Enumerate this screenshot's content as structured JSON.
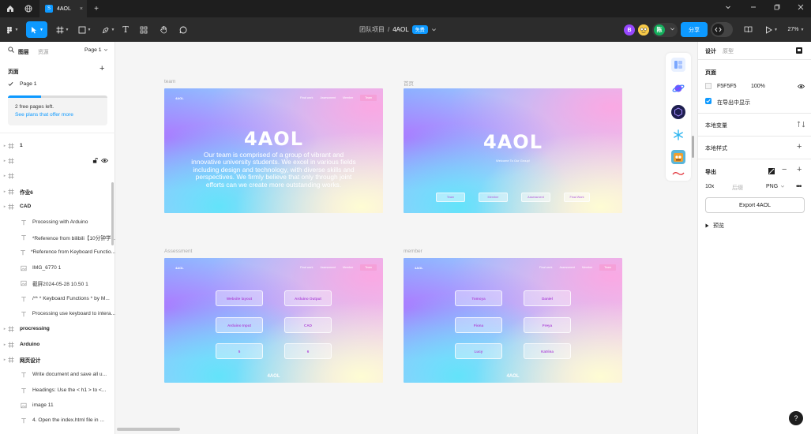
{
  "tabbar": {
    "tab_title": "4AOL",
    "tab_logo": "S",
    "close": "×",
    "new_tab": "+"
  },
  "toolbar": {
    "team": "团队项目",
    "separator": "/",
    "file": "4AOL",
    "free_badge": "免费",
    "avatars": [
      {
        "letter": "B",
        "color": "#9747ff"
      },
      {
        "letter": "陈",
        "color": "#14ae5c"
      }
    ],
    "share": "分享",
    "zoom": "27%"
  },
  "left_panel": {
    "tab_layers": "图层",
    "tab_assets": "资源",
    "page_selector": "Page 1",
    "pages_label": "页面",
    "current_page": "Page 1",
    "plans": {
      "line1": "2 free pages left.",
      "link": "See plans that offer more",
      "used_fraction": 0.33
    },
    "layers": [
      {
        "label": "1",
        "icon": "frame",
        "bold": true
      },
      {
        "label": "",
        "icon": "frame",
        "bold": false
      },
      {
        "label": "",
        "icon": "frame",
        "bold": false
      },
      {
        "label": "作业6",
        "icon": "frame",
        "bold": true
      },
      {
        "label": "CAD",
        "icon": "frame",
        "bold": true
      },
      {
        "label": "Processing with Arduino",
        "icon": "text",
        "bold": false
      },
      {
        "label": "*Reference from bilibili【10分钟学...",
        "icon": "text",
        "bold": false
      },
      {
        "label": "*Reference from Keyboard Functio...",
        "icon": "text",
        "bold": false
      },
      {
        "label": "IMG_6770 1",
        "icon": "image",
        "bold": false
      },
      {
        "label": "截屏2024-05-28 10.50 1",
        "icon": "image",
        "bold": false
      },
      {
        "label": "/** * Keyboard Functions  * by M...",
        "icon": "text",
        "bold": false
      },
      {
        "label": "Processing use keyboard to intera...",
        "icon": "text",
        "bold": false
      },
      {
        "label": "procressing",
        "icon": "frame",
        "bold": true
      },
      {
        "label": "Arduino",
        "icon": "frame",
        "bold": true
      },
      {
        "label": "网页设计",
        "icon": "frame",
        "bold": true
      },
      {
        "label": "Write document and save all u...",
        "icon": "text",
        "bold": false
      },
      {
        "label": "Headings: Use the < h1 > to <...",
        "icon": "text",
        "bold": false
      },
      {
        "label": "image 11",
        "icon": "image",
        "bold": false
      },
      {
        "label": "4. Open the index.html file in ...",
        "icon": "text",
        "bold": false
      }
    ]
  },
  "canvas": {
    "frames": {
      "team": {
        "label": "team",
        "nav": [
          "Final work",
          "Assessment",
          "Member",
          "Team"
        ],
        "logo": "4AOL",
        "small_logo": "4AOL",
        "body": "Our team is comprised of a group of vibrant and innovative university students. We excel in various fields including design and technology, with diverse skills and perspectives. We firmly believe that only through joint efforts can we create more outstanding works."
      },
      "home": {
        "label": "首页",
        "logo": "4AOL",
        "welcome": "Welcome To Our Group!",
        "buttons": [
          "Team",
          "Member",
          "Assessment",
          "Final Work"
        ]
      },
      "assessment": {
        "label": "Assessment",
        "nav": [
          "Final work",
          "Assessment",
          "Member",
          "Team"
        ],
        "small_logo": "4AOL",
        "cards": [
          "Website layout",
          "Arduino Output",
          "Arduino Input",
          "CAD",
          "5",
          "6"
        ],
        "footer": "4AOL"
      },
      "member": {
        "label": "member",
        "nav": [
          "Final work",
          "Assessment",
          "Member",
          "Team"
        ],
        "small_logo": "4AOL",
        "cards": [
          "Tomoya",
          "Daniel",
          "Fiona",
          "Freya",
          "Lucy",
          "Katrina"
        ],
        "footer": "4AOL"
      }
    }
  },
  "right_panel": {
    "tab_design": "设计",
    "tab_prototype": "原型",
    "page_heading": "页面",
    "bg_color": "F5F5F5",
    "bg_opacity": "100%",
    "show_in_export": "在导出中显示",
    "local_variables": "本地变量",
    "local_styles": "本地样式",
    "export_heading": "导出",
    "export_scale": "10x",
    "export_suffix_placeholder": "后缀",
    "export_format": "PNG",
    "export_button": "Export 4AOL",
    "preview": "预览"
  },
  "help": "?"
}
